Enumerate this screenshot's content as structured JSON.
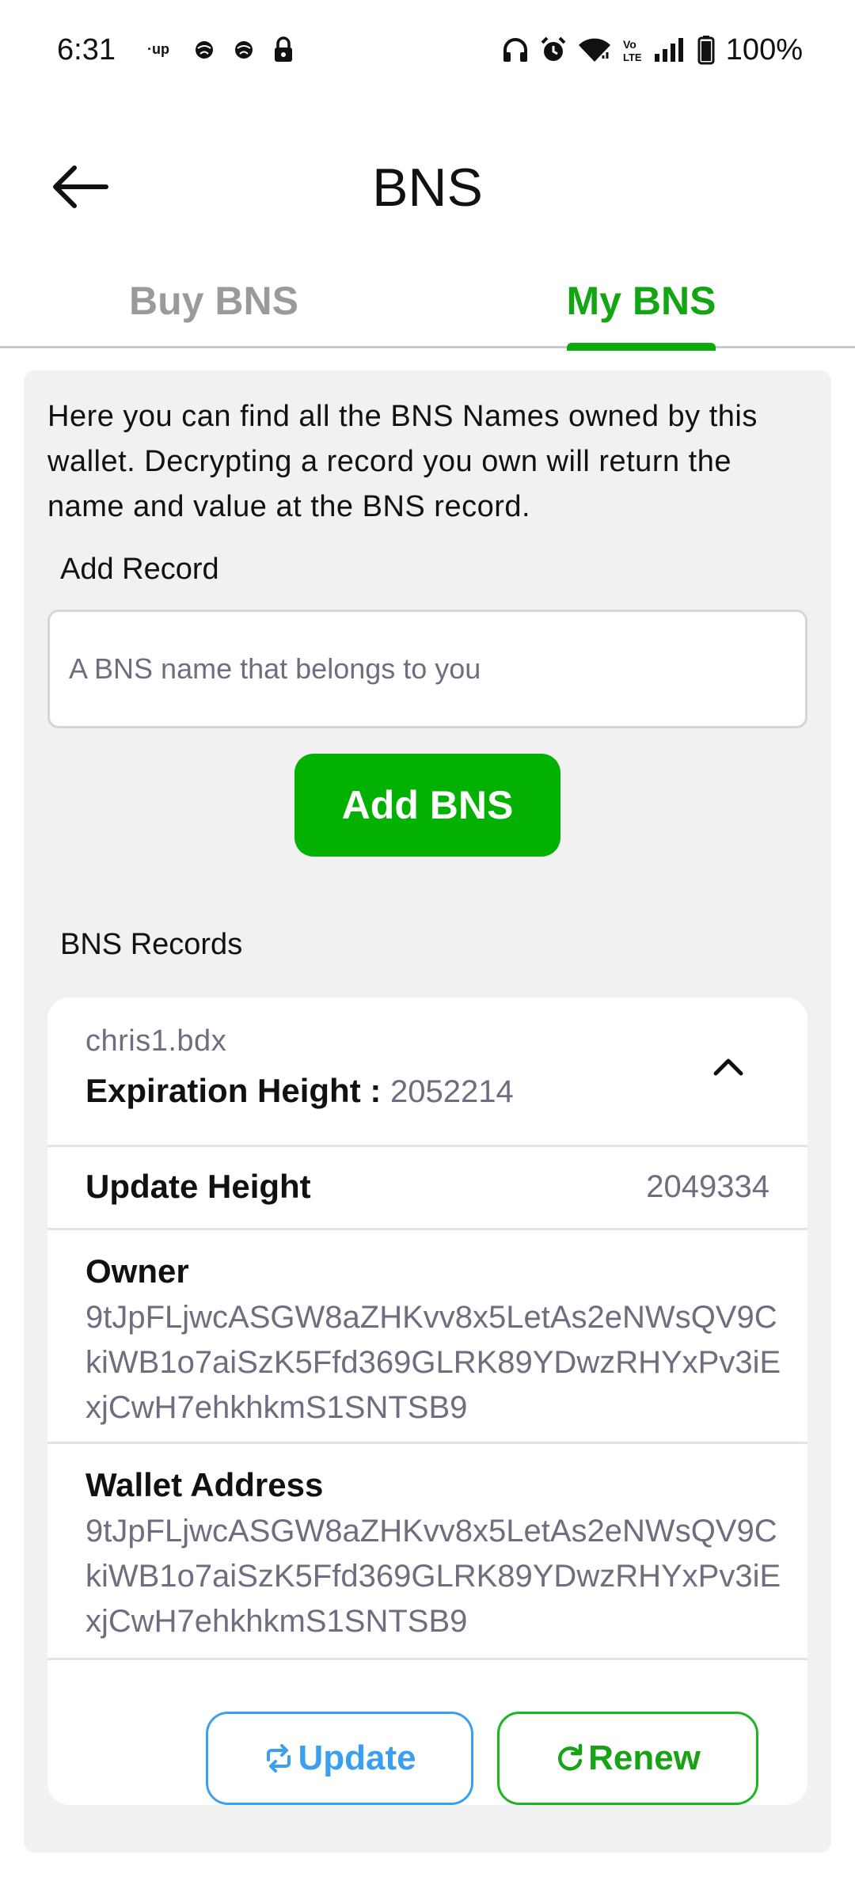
{
  "status_bar": {
    "time": "6:31",
    "battery_text": "100%",
    "left_icons": [
      "up-icon",
      "ball-icon",
      "ball-icon",
      "lock-icon"
    ],
    "right_icons": [
      "headphones-icon",
      "alarm-icon",
      "wifi-icon",
      "volte-icon",
      "signal-icon",
      "battery-icon"
    ],
    "volte_text": "Vo LTE",
    "up_text": "·up"
  },
  "app_bar": {
    "title": "BNS",
    "back_icon": "arrow-left-icon"
  },
  "tabs": [
    {
      "label": "Buy BNS",
      "active": false
    },
    {
      "label": "My BNS",
      "active": true
    }
  ],
  "main": {
    "intro": "Here you can find all the BNS Names owned by this wallet. Decrypting a record you own will return the name and value at the BNS record.",
    "add_record_label": "Add Record",
    "input_placeholder": "A BNS name that belongs to you",
    "input_value": "",
    "add_button": "Add BNS",
    "records_label": "BNS Records"
  },
  "record": {
    "name": "chris1.bdx",
    "expiration_label": "Expiration Height :",
    "expiration_value": "2052214",
    "update_height_label": "Update Height",
    "update_height_value": "2049334",
    "owner_label": "Owner",
    "owner_value": "9tJpFLjwcASGW8aZHKvv8x5LetAs2eNWsQV9CkiWB1o7aiSzK5Ffd369GLRK89YDwzRHYxPv3iExjCwH7ehkhkmS1SNTSB9",
    "wallet_label": "Wallet Address",
    "wallet_value": "9tJpFLjwcASGW8aZHKvv8x5LetAs2eNWsQV9CkiWB1o7aiSzK5Ffd369GLRK89YDwzRHYxPv3iExjCwH7ehkhkmS1SNTSB9",
    "update_button": "Update",
    "renew_button": "Renew",
    "collapse_icon": "chevron-up-icon"
  },
  "colors": {
    "accent_green": "#02b102",
    "tab_active": "#14a514",
    "update_blue": "#3a9ff0",
    "muted_text": "#6e6e80"
  }
}
